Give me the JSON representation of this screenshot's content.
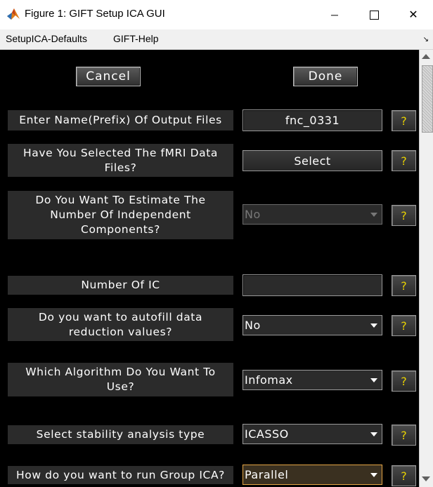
{
  "window": {
    "title": "Figure 1: GIFT Setup ICA GUI",
    "minimize_symbol": "─",
    "maximize_symbol": "☐",
    "close_symbol": "✕",
    "icon": "matlab-logo-icon"
  },
  "menu": {
    "items": [
      "SetupICA-Defaults",
      "GIFT-Help"
    ],
    "overflow_symbol": "↘"
  },
  "buttons": {
    "cancel": "Cancel",
    "done": "Done"
  },
  "help_label": "?",
  "rows": [
    {
      "label": "Enter Name(Prefix) Of Output Files",
      "control": "text",
      "value": "fnc_0331"
    },
    {
      "label": "Have You Selected The fMRI Data Files?",
      "control": "button",
      "value": "Select"
    },
    {
      "label": "Do You Want To Estimate The Number Of Independent Components?",
      "control": "dropdown",
      "value": "No",
      "state": "disabled"
    },
    {
      "label": "Number Of IC",
      "control": "text",
      "value": ""
    },
    {
      "label": "Do you want to autofill data reduction values?",
      "control": "dropdown",
      "value": "No"
    },
    {
      "label": "Which Algorithm Do You Want To Use?",
      "control": "dropdown",
      "value": "Infomax"
    },
    {
      "label": "Select stability analysis type",
      "control": "dropdown",
      "value": "ICASSO"
    },
    {
      "label": "How do you want to run Group ICA?",
      "control": "dropdown",
      "value": "Parallel",
      "state": "focused"
    }
  ],
  "colors": {
    "background": "#000000",
    "label_bg": "#2b2b2b",
    "help_text": "#e8d200",
    "focus_border": "#e5a545"
  }
}
